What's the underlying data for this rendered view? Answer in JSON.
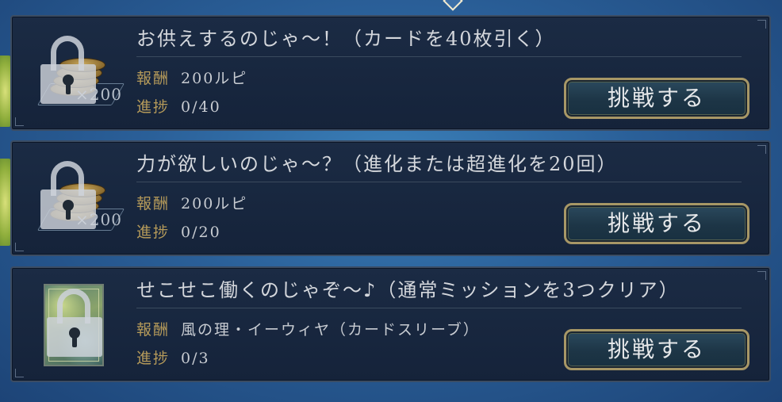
{
  "missions": [
    {
      "title": "お供えするのじゃ～！（カードを40枚引く）",
      "reward_label": "報酬",
      "reward_value": "200ルピ",
      "reward_icon": "rupee-coin-stack-icon",
      "reward_count": "×200",
      "progress_label": "進捗",
      "progress_value": "0/40",
      "progress_fraction": 0.0,
      "locked": true,
      "button_label": "挑戦する"
    },
    {
      "title": "力が欲しいのじゃ～？（進化または超進化を20回）",
      "reward_label": "報酬",
      "reward_value": "200ルピ",
      "reward_icon": "rupee-coin-stack-icon",
      "reward_count": "×200",
      "progress_label": "進捗",
      "progress_value": "0/20",
      "progress_fraction": 0.0,
      "locked": true,
      "button_label": "挑戦する"
    },
    {
      "title": "せこせこ働くのじゃぞ～♪（通常ミッションを3つクリア）",
      "reward_label": "報酬",
      "reward_value": "風の理・イーウィヤ（カードスリーブ）",
      "reward_icon": "card-sleeve-icon",
      "progress_label": "進捗",
      "progress_value": "0/3",
      "progress_fraction": 0.0,
      "locked": true,
      "button_label": "挑戦する"
    }
  ],
  "colors": {
    "panel": "#1b2b44",
    "label_gold": "#b59a5a",
    "text": "#d4d7dc",
    "button_border": "#a79766"
  }
}
